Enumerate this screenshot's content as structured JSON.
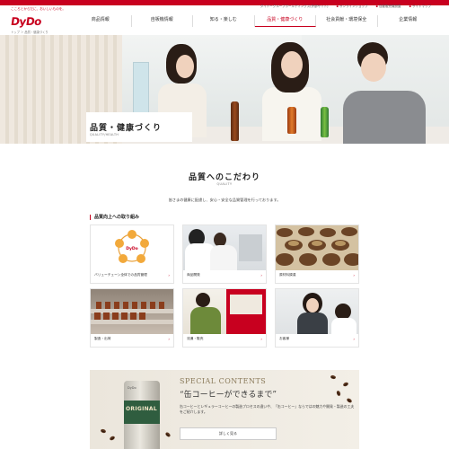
{
  "header": {
    "logo_tagline": "こころとからだに、おいしいものを。",
    "logo_brand": "DyDo",
    "util_links": [
      "ダイドーグループホールディングス(外部サイト)",
      "オンラインショップ",
      "自動販売機設置",
      "サイトマップ"
    ],
    "nav": [
      {
        "label": "商品情報",
        "active": false
      },
      {
        "label": "自販機情報",
        "active": false
      },
      {
        "label": "知る・楽しむ",
        "active": false
      },
      {
        "label": "品質・健康づくり",
        "active": true
      },
      {
        "label": "社会貢献・環境保全",
        "active": false
      },
      {
        "label": "企業情報",
        "active": false
      }
    ]
  },
  "breadcrumb": "トップ ＞ 品質・健康づくり",
  "hero": {
    "title": "品質・健康づくり",
    "subtitle": "QUALITY/HEALTH"
  },
  "quality": {
    "title": "品質へのこだわり",
    "subtitle": "QUALITY",
    "intro": "皆さまの健康に配慮し、安心・安全な品質管理を行っております。"
  },
  "initiatives": {
    "heading": "品質向上への取り組み",
    "cards": [
      {
        "label": "バリューチェーン全体での品質管理",
        "icon": "value-chain"
      },
      {
        "label": "商品開発",
        "icon": "product-development"
      },
      {
        "label": "原材料調達",
        "icon": "raw-materials"
      },
      {
        "label": "製造・出荷",
        "icon": "manufacturing"
      },
      {
        "label": "流通・販売",
        "icon": "distribution"
      },
      {
        "label": "お客様",
        "icon": "customers"
      }
    ],
    "arrow": "›"
  },
  "special": {
    "label": "SPECIAL CONTENTS",
    "title": "“缶コーヒーができるまで”",
    "body": "缶コーヒーとレギュラーコーヒーの製造プロセスの違いや、「缶コーヒー」ならではの魅力や開発・製造の工夫をご紹介します。",
    "button": "詳しく見る",
    "can_text": "ORIGINAL",
    "can_brand": "DyDo"
  },
  "colors": {
    "accent": "#c8001f"
  }
}
